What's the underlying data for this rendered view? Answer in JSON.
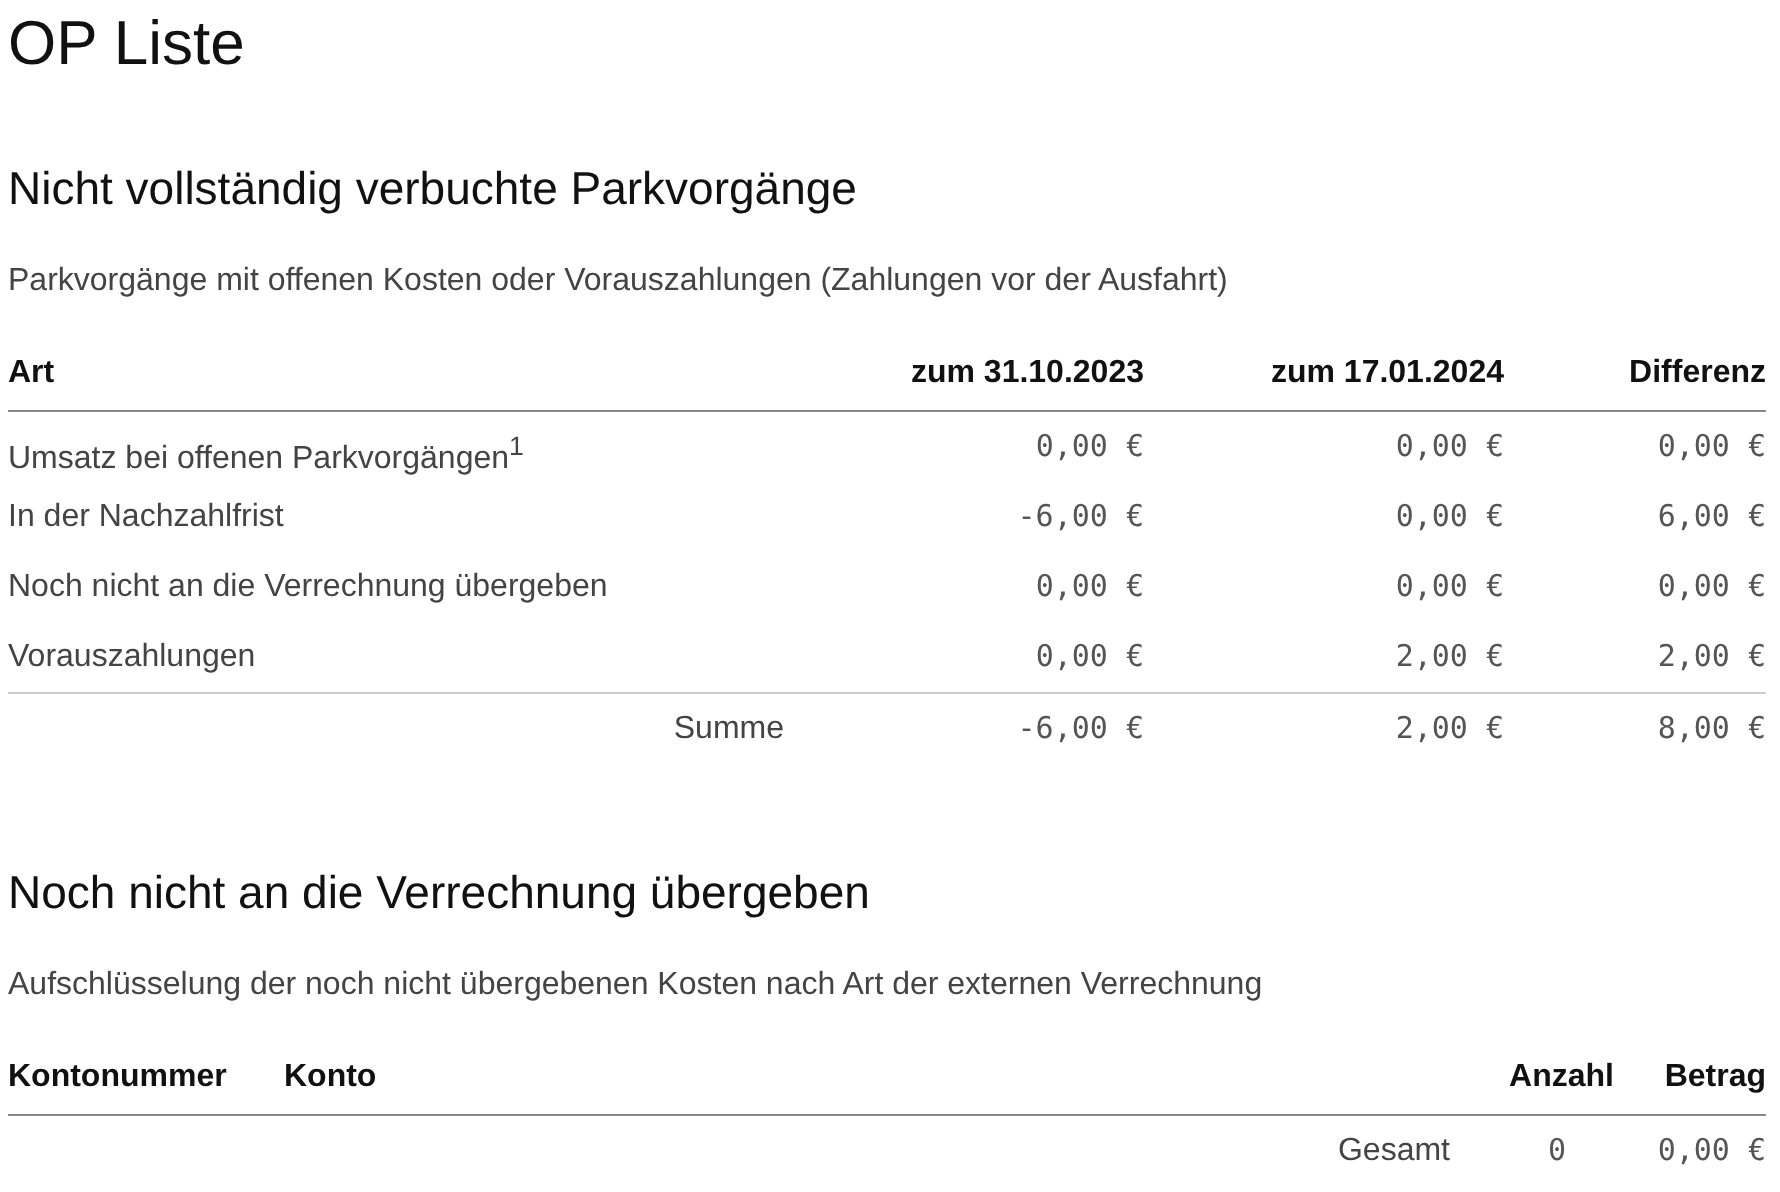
{
  "title": "OP Liste",
  "section1": {
    "heading": "Nicht vollständig verbuchte Parkvorgänge",
    "description": "Parkvorgänge mit offenen Kosten oder Vorauszahlungen (Zahlungen vor der Ausfahrt)",
    "columns": [
      "Art",
      "zum 31.10.2023",
      "zum 17.01.2024",
      "Differenz"
    ],
    "rows": [
      {
        "label": "Umsatz bei offenen Parkvorgängen$^{1}$",
        "values": [
          "0,00 €",
          "0,00 €",
          "0,00 €"
        ]
      },
      {
        "label": "In der Nachzahlfrist",
        "values": [
          "-6,00 €",
          "0,00 €",
          "6,00 €"
        ]
      },
      {
        "label": "Noch nicht an die Verrechnung übergeben",
        "values": [
          "0,00 €",
          "0,00 €",
          "0,00 €"
        ]
      },
      {
        "label": "Vorauszahlungen",
        "values": [
          "0,00 €",
          "2,00 €",
          "2,00 €"
        ]
      }
    ],
    "total": {
      "label": "Summe",
      "values": [
        "-6,00 €",
        "2,00 €",
        "8,00 €"
      ]
    }
  },
  "section2": {
    "heading": "Noch nicht an die Verrechnung übergeben",
    "description": "Aufschlüsselung der noch nicht übergebenen Kosten nach Art der externen Verrechnung",
    "columns": [
      "Kontonummer",
      "Konto",
      "Anzahl",
      "Betrag"
    ],
    "total": {
      "label": "Gesamt",
      "values": [
        "0",
        "0,00 €"
      ]
    }
  }
}
